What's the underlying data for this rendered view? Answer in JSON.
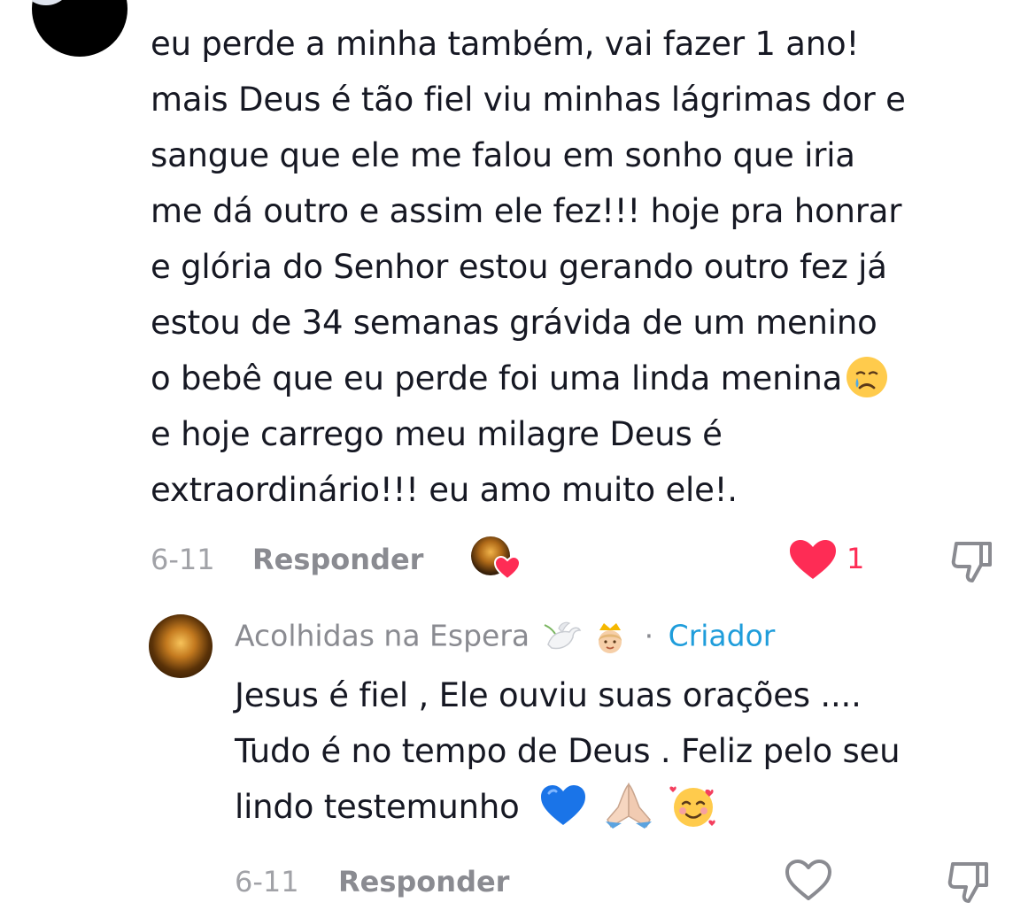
{
  "comment": {
    "lines": [
      "eu perde a minha também, vai fazer 1 ano!",
      "mais Deus é tão fiel viu minhas lágrimas dor e",
      "sangue que ele me falou em sonho que iria",
      "me dá outro e assim ele fez!!! hoje pra honrar",
      "e glória do Senhor estou gerando outro fez já",
      "estou de 34 semanas grávida de um menino",
      "o bebê que eu perde foi uma linda menina",
      "e hoje carrego meu milagre Deus é",
      "extraordinário!!! eu amo muito ele!."
    ],
    "emoji_after_line_7": "crying-face-emoji",
    "date": "6-11",
    "reply_label": "Responder",
    "like_count": "1",
    "liked": true,
    "liked_by_creator": true
  },
  "reply": {
    "username": "Acolhidas na Espera",
    "username_emojis": [
      "dove-emoji",
      "princess-emoji"
    ],
    "separator": "·",
    "creator_badge": "Criador",
    "lines": [
      "Jesus é fiel , Ele ouviu suas orações ....",
      "Tudo é no tempo de Deus . Feliz pelo seu",
      "lindo testemunho"
    ],
    "trailing_emojis": [
      "blue-heart-emoji",
      "folded-hands-emoji",
      "smiling-face-with-hearts-emoji"
    ],
    "date": "6-11",
    "reply_label": "Responder",
    "liked": false
  },
  "colors": {
    "like_red": "#fe2c55",
    "creator_blue": "#1f9ddb",
    "meta_gray": "#8a8b91",
    "text": "#161823"
  }
}
